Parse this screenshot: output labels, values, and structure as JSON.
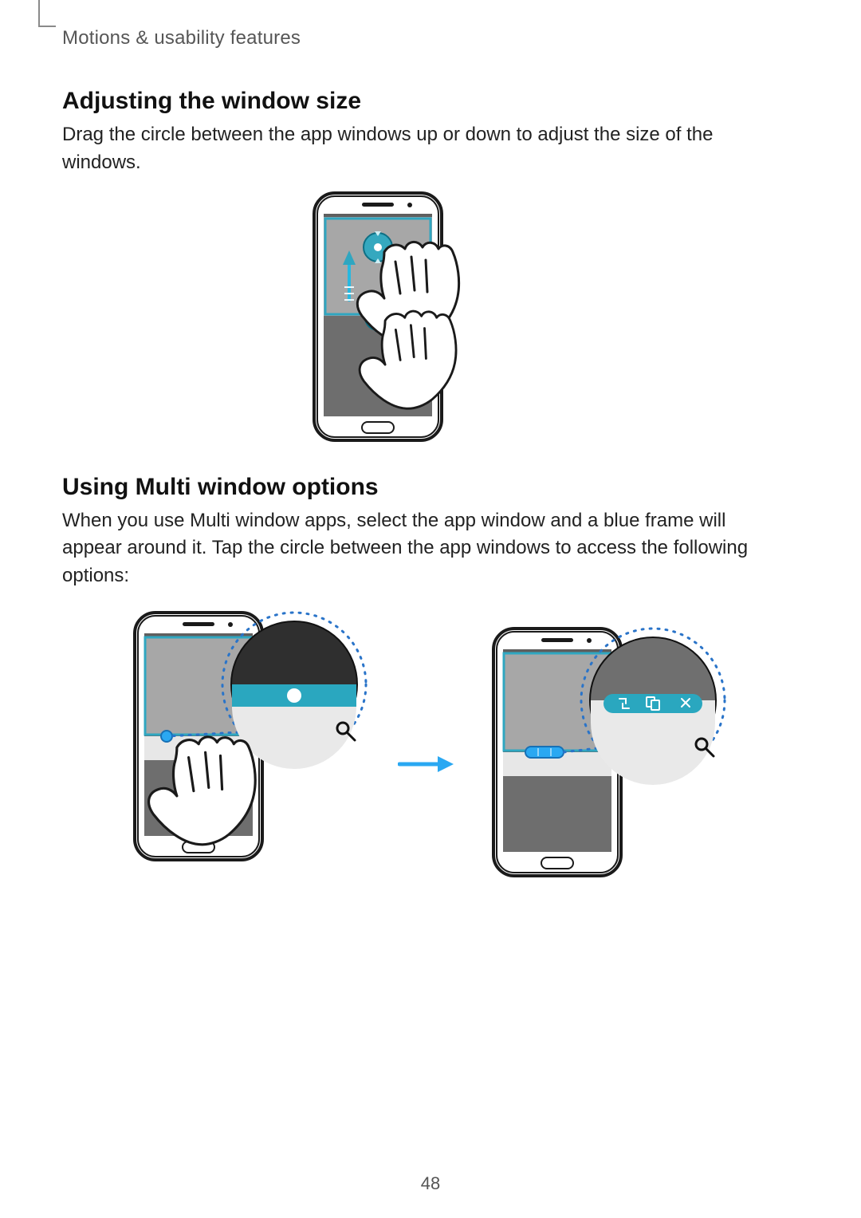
{
  "breadcrumb": "Motions & usability features",
  "sections": {
    "adjust": {
      "title": "Adjusting the window size",
      "body": "Drag the circle between the app windows up or down to adjust the size of the windows."
    },
    "options": {
      "title": "Using Multi window options",
      "body": "When you use Multi window apps, select the app window and a blue frame will appear around it. Tap the circle between the app windows to access the following options:"
    }
  },
  "page_number": "48"
}
